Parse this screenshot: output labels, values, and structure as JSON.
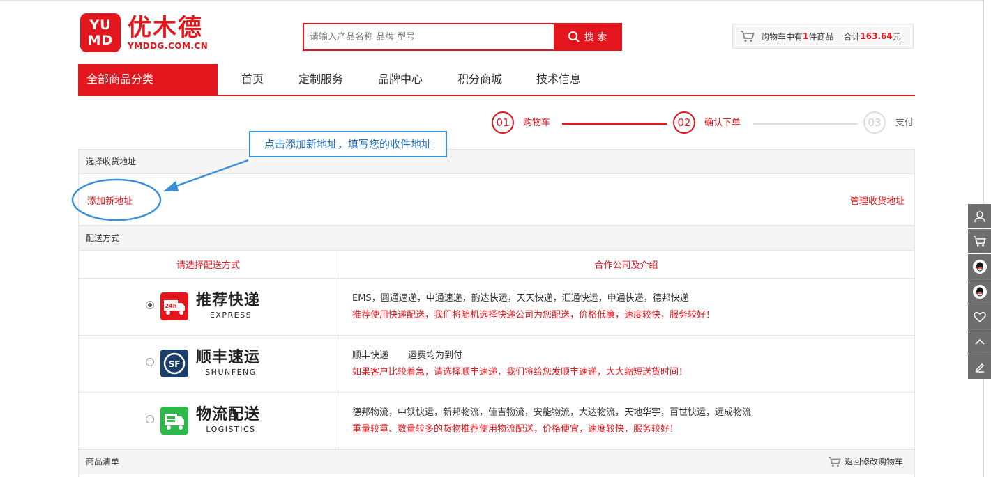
{
  "logo": {
    "badge_top": "YU",
    "badge_bottom": "MD",
    "name": "优木德",
    "domain": "YMDDG.COM.CN"
  },
  "search": {
    "placeholder": "请输入产品名称 品牌 型号",
    "button_label": "搜 索"
  },
  "cart_summary": {
    "prefix": "购物车中有",
    "count": "1",
    "suffix": "件商品",
    "total_label": "合计",
    "total_value": "163.64",
    "currency": "元"
  },
  "nav": {
    "category_label": "全部商品分类",
    "items": [
      "首页",
      "定制服务",
      "品牌中心",
      "积分商城",
      "技术信息"
    ]
  },
  "steps": [
    {
      "num": "01",
      "label": "购物车"
    },
    {
      "num": "02",
      "label": "确认下单"
    },
    {
      "num": "03",
      "label": "支付"
    }
  ],
  "annotation": {
    "text": "点击添加新地址，填写您的收件地址"
  },
  "address": {
    "title": "选择收货地址",
    "add_label": "添加新地址",
    "manage_label": "管理收货地址"
  },
  "shipping": {
    "title": "配送方式",
    "col_choose": "请选择配送方式",
    "col_company": "合作公司及介绍",
    "options": [
      {
        "title": "推荐快递",
        "sub": "EXPRESS",
        "badge": "24h",
        "desc1": "EMS，圆通速递，中通速递，韵达快运，天天快递，汇通快运，申通快递，德邦快递",
        "desc2": "推荐使用快递配送，我们将随机选择快递公司为您配送，价格低廉，速度较快，服务较好！",
        "checked": true
      },
      {
        "title": "顺丰速运",
        "sub": "SHUNFENG",
        "badge": "SF",
        "desc1a": "顺丰快递",
        "desc1b": "运费均为到付",
        "desc2": "如果客户比较着急，请选择顺丰速递，我们将给您发顺丰速递，大大缩短送货时间！",
        "checked": false
      },
      {
        "title": "物流配送",
        "sub": "LOGISTICS",
        "desc1": "德邦物流，中铁快运，新邦物流，佳吉物流，安能物流，大达物流，天地华宇，百世快运，远成物流",
        "desc2": "重量较重、数量较多的货物推荐使用物流配送，价格便宜，速度较快，服务较好！",
        "checked": false
      }
    ]
  },
  "goods": {
    "title": "商品清单",
    "back_label": "返回修改购物车"
  },
  "colors": {
    "brand": "#e4161d",
    "annotation": "#3a8fd9",
    "sidebar": "#6e6e6e"
  }
}
